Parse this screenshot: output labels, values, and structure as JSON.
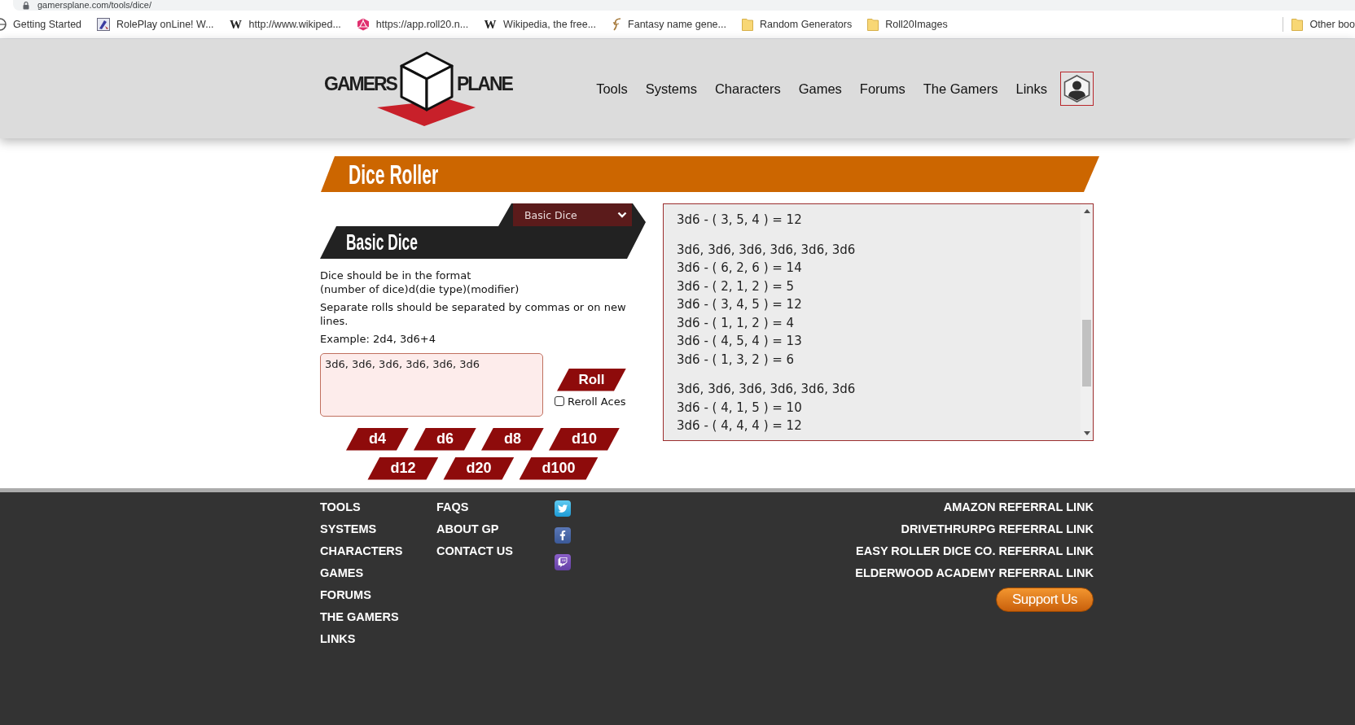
{
  "address_bar": {
    "url": "gamersplane.com/tools/dice/"
  },
  "bookmarks": [
    {
      "label": "Getting Started",
      "kind": "globe"
    },
    {
      "label": "RolePlay onLine! W...",
      "kind": "tile"
    },
    {
      "label": "http://www.wikiped...",
      "kind": "letter",
      "letter": "W"
    },
    {
      "label": "https://app.roll20.n...",
      "kind": "die"
    },
    {
      "label": "Wikipedia, the free...",
      "kind": "letter",
      "letter": "W"
    },
    {
      "label": "Fantasy name gene...",
      "kind": "quill"
    },
    {
      "label": "Random Generators",
      "kind": "folder"
    },
    {
      "label": "Roll20Images",
      "kind": "folder"
    }
  ],
  "other_bookmarks": {
    "label": "Other boo"
  },
  "logo": {
    "left": "GAMERS",
    "right": "PLANE"
  },
  "nav": [
    "Tools",
    "Systems",
    "Characters",
    "Games",
    "Forums",
    "The Gamers",
    "Links"
  ],
  "page_title": "Dice Roller",
  "roller": {
    "mode_select": {
      "value": "Basic Dice"
    },
    "title": "Basic Dice",
    "instructions": [
      "Dice should be in the format\n(number of dice)d(die type)(modifier)",
      "Separate rolls should be separated by commas or on new lines.",
      "Example: 2d4, 3d6+4"
    ],
    "input": {
      "value": "3d6, 3d6, 3d6, 3d6, 3d6, 3d6"
    },
    "roll_button": "Roll",
    "reroll_aces": {
      "label": "Reroll Aces",
      "checked": false
    },
    "dice_buttons": [
      "d4",
      "d6",
      "d8",
      "d10",
      "d12",
      "d20",
      "d100"
    ]
  },
  "results": [
    {
      "lines": [
        "3d6 - ( 3, 5, 4 ) = 12"
      ]
    },
    {
      "input": "3d6, 3d6, 3d6, 3d6, 3d6, 3d6",
      "lines": [
        "3d6 - ( 6, 2, 6 ) = 14",
        "3d6 - ( 2, 1, 2 ) = 5",
        "3d6 - ( 3, 4, 5 ) = 12",
        "3d6 - ( 1, 1, 2 ) = 4",
        "3d6 - ( 4, 5, 4 ) = 13",
        "3d6 - ( 1, 3, 2 ) = 6"
      ]
    },
    {
      "input": "3d6, 3d6, 3d6, 3d6, 3d6, 3d6",
      "lines": [
        "3d6 - ( 4, 1, 5 ) = 10",
        "3d6 - ( 4, 4, 4 ) = 12"
      ]
    }
  ],
  "footer": {
    "column_1": [
      "TOOLS",
      "SYSTEMS",
      "CHARACTERS",
      "GAMES",
      "FORUMS",
      "THE GAMERS",
      "LINKS"
    ],
    "column_2": [
      "FAQS",
      "ABOUT GP",
      "CONTACT US"
    ],
    "referral_links": [
      "AMAZON REFERRAL LINK",
      "DRIVETHRURPG REFERRAL LINK",
      "EASY ROLLER DICE CO. REFERRAL LINK",
      "ELDERWOOD ACADEMY REFERRAL LINK"
    ],
    "support_button": "Support Us"
  }
}
